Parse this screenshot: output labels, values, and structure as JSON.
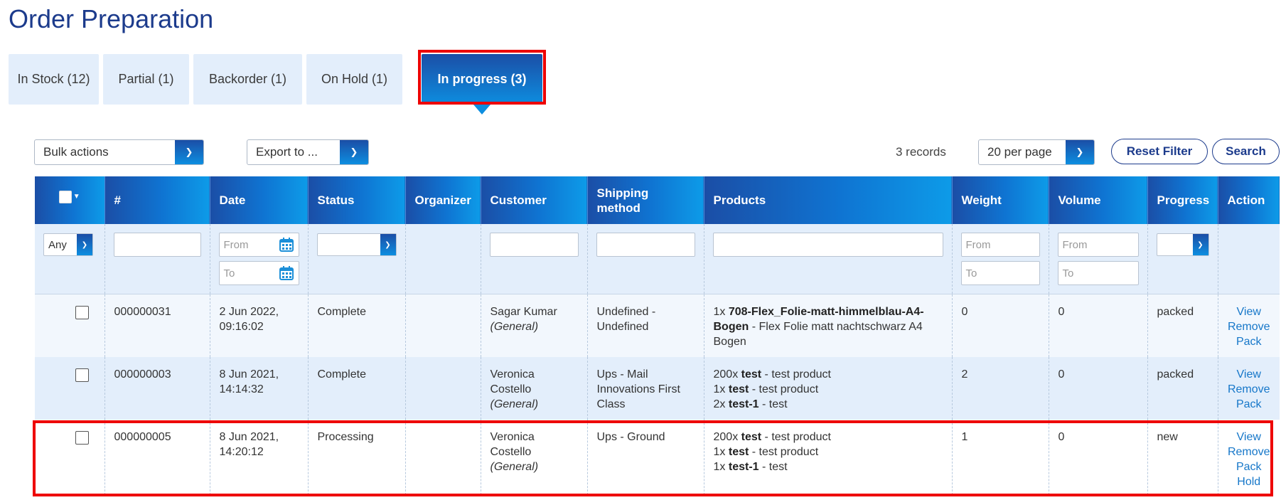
{
  "page": {
    "title": "Order Preparation"
  },
  "tabs": [
    {
      "label": "In Stock (12)"
    },
    {
      "label": "Partial (1)"
    },
    {
      "label": "Backorder (1)"
    },
    {
      "label": "On Hold (1)"
    },
    {
      "label": "In progress (3)",
      "active": true
    }
  ],
  "toolbar": {
    "bulk_actions": "Bulk actions",
    "export_to": "Export to ...",
    "records": "3 records",
    "per_page": "20 per page",
    "reset_filter": "Reset Filter",
    "search": "Search"
  },
  "columns": [
    "#",
    "Date",
    "Status",
    "Organizer",
    "Customer",
    "Shipping method",
    "Products",
    "Weight",
    "Volume",
    "Progress",
    "Action"
  ],
  "filters": {
    "select_any": "Any",
    "date_from": "From",
    "date_to": "To",
    "weight_from": "From",
    "weight_to": "To",
    "volume_from": "From",
    "volume_to": "To"
  },
  "rows": [
    {
      "id": "000000031",
      "date": "2 Jun 2022,",
      "time": "09:16:02",
      "status": "Complete",
      "organizer": "",
      "customer": "Sagar Kumar",
      "customer_group": "(General)",
      "shipping": "Undefined - Undefined",
      "products": [
        {
          "qty": "1x",
          "sku": "708-Flex_Folie-matt-himmelblau-A4-Bogen",
          "name": " - Flex Folie matt nachtschwarz A4 Bogen"
        }
      ],
      "weight": "0",
      "volume": "0",
      "progress": "packed",
      "actions": [
        "View",
        "Remove",
        "Pack"
      ]
    },
    {
      "id": "000000003",
      "date": "8 Jun 2021,",
      "time": "14:14:32",
      "status": "Complete",
      "organizer": "",
      "customer": "Veronica Costello",
      "customer_group": "(General)",
      "shipping": "Ups - Mail Innovations First Class",
      "products": [
        {
          "qty": "200x",
          "sku": "test",
          "name": " - test product"
        },
        {
          "qty": "1x",
          "sku": "test",
          "name": " - test product"
        },
        {
          "qty": "2x",
          "sku": "test-1",
          "name": " - test"
        }
      ],
      "weight": "2",
      "volume": "0",
      "progress": "packed",
      "actions": [
        "View",
        "Remove",
        "Pack"
      ]
    },
    {
      "id": "000000005",
      "date": "8 Jun 2021,",
      "time": "14:20:12",
      "status": "Processing",
      "organizer": "",
      "customer": "Veronica Costello",
      "customer_group": "(General)",
      "shipping": "Ups - Ground",
      "products": [
        {
          "qty": "200x",
          "sku": "test",
          "name": " - test product"
        },
        {
          "qty": "1x",
          "sku": "test",
          "name": " - test product"
        },
        {
          "qty": "1x",
          "sku": "test-1",
          "name": " - test"
        }
      ],
      "weight": "1",
      "volume": "0",
      "progress": "new",
      "actions": [
        "View",
        "Remove",
        "Pack",
        "Hold"
      ]
    }
  ],
  "colors": {
    "title": "#1c3b8c",
    "tab_bg": "#e3eefb",
    "accent_dark": "#1b4ea6",
    "accent_light": "#0d8ee0",
    "link": "#1677c9",
    "highlight": "#e00000"
  }
}
